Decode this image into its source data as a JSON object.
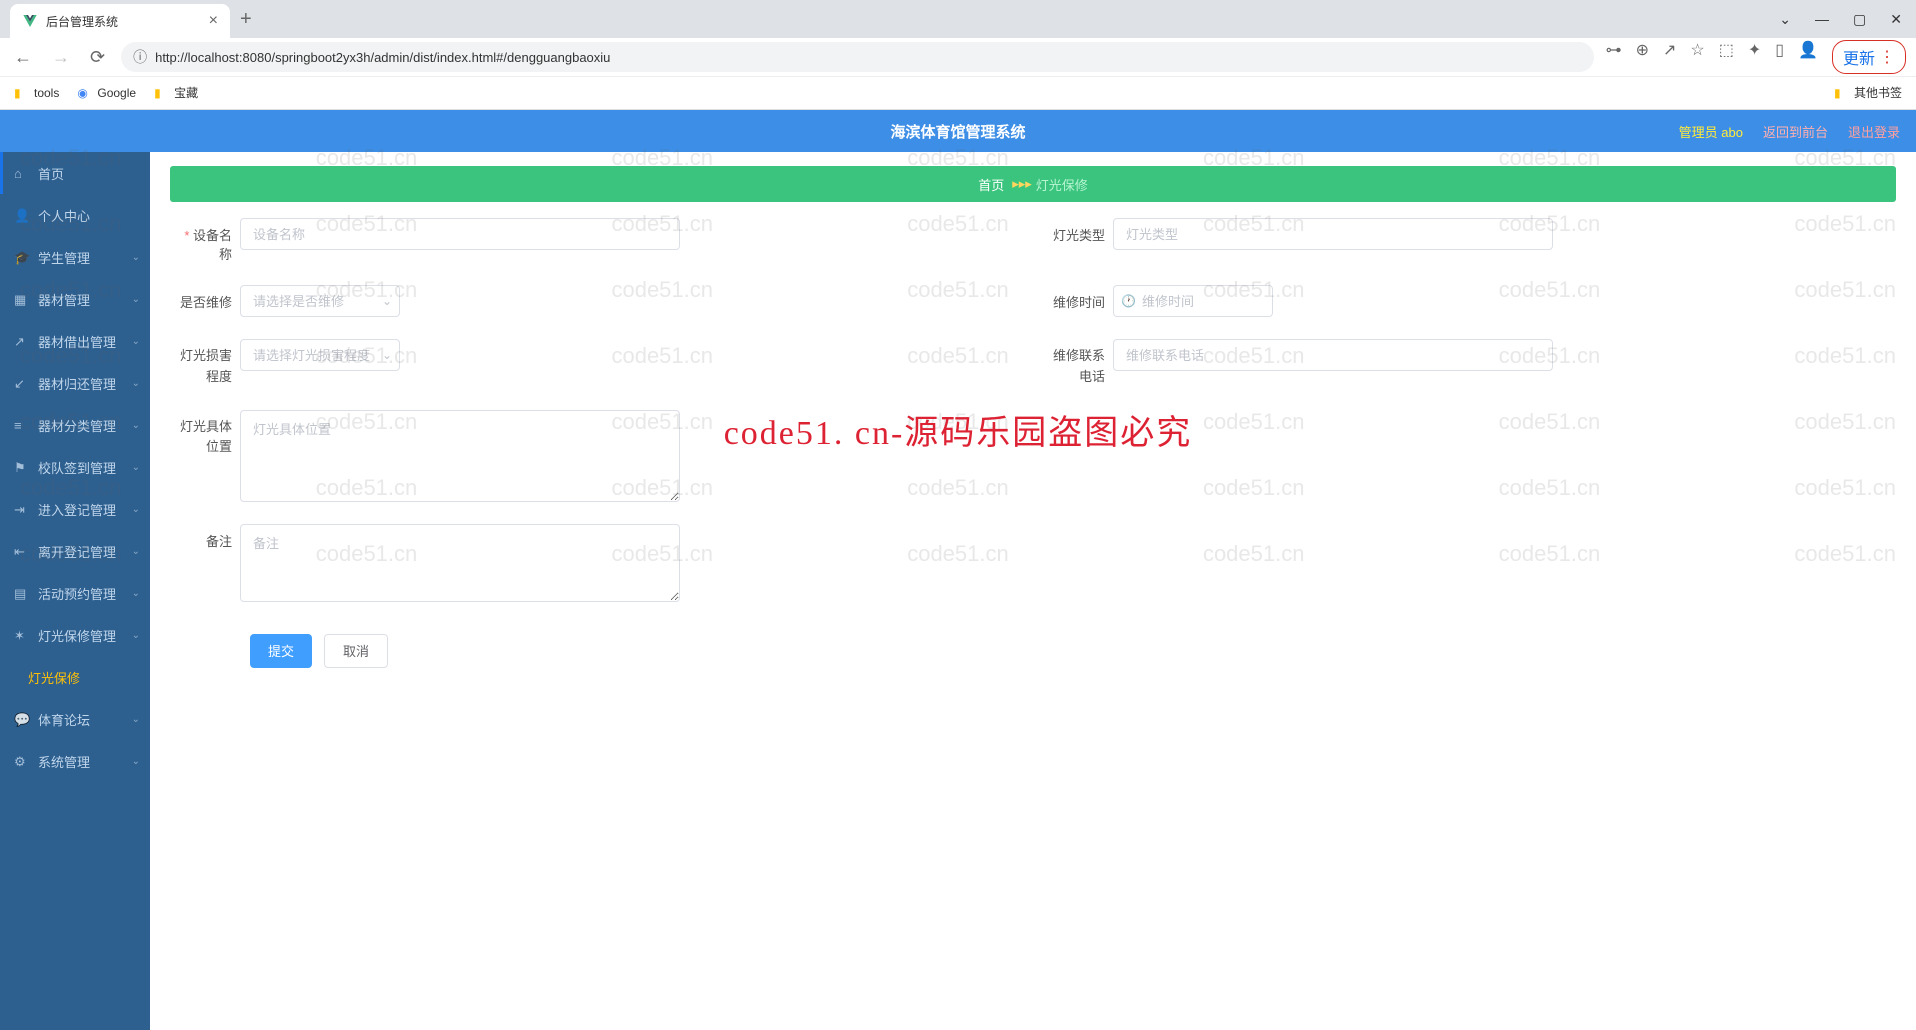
{
  "browser": {
    "tab_title": "后台管理系统",
    "url": "http://localhost:8080/springboot2yx3h/admin/dist/index.html#/dengguangbaoxiu",
    "bookmarks": [
      {
        "label": "tools",
        "type": "folder"
      },
      {
        "label": "Google",
        "type": "link"
      },
      {
        "label": "宝藏",
        "type": "folder"
      }
    ],
    "other_bookmarks": "其他书签",
    "update_label": "更新"
  },
  "header": {
    "title": "海滨体育馆管理系统",
    "admin": "管理员 abo",
    "return_link": "返回到前台",
    "logout_link": "退出登录"
  },
  "sidebar": {
    "items": [
      {
        "label": "首页",
        "has_children": false
      },
      {
        "label": "个人中心",
        "has_children": false
      },
      {
        "label": "学生管理",
        "has_children": true
      },
      {
        "label": "器材管理",
        "has_children": true
      },
      {
        "label": "器材借出管理",
        "has_children": true
      },
      {
        "label": "器材归还管理",
        "has_children": true
      },
      {
        "label": "器材分类管理",
        "has_children": true
      },
      {
        "label": "校队签到管理",
        "has_children": true
      },
      {
        "label": "进入登记管理",
        "has_children": true
      },
      {
        "label": "离开登记管理",
        "has_children": true
      },
      {
        "label": "活动预约管理",
        "has_children": true
      },
      {
        "label": "灯光保修管理",
        "has_children": true
      },
      {
        "label": "灯光保修",
        "has_children": false,
        "active": true,
        "sub": true
      },
      {
        "label": "体育论坛",
        "has_children": true
      },
      {
        "label": "系统管理",
        "has_children": true
      }
    ]
  },
  "breadcrumb": {
    "home": "首页",
    "current": "灯光保修"
  },
  "form": {
    "device_name": {
      "label": "设备名称",
      "placeholder": "设备名称"
    },
    "light_type": {
      "label": "灯光类型",
      "placeholder": "灯光类型"
    },
    "need_repair": {
      "label": "是否维修",
      "placeholder": "请选择是否维修"
    },
    "repair_time": {
      "label": "维修时间",
      "placeholder": "维修时间"
    },
    "damage_level": {
      "label": "灯光损害程度",
      "placeholder": "请选择灯光损害程度"
    },
    "contact_phone": {
      "label": "维修联系电话",
      "placeholder": "维修联系电话"
    },
    "position": {
      "label": "灯光具体位置",
      "placeholder": "灯光具体位置"
    },
    "remark": {
      "label": "备注",
      "placeholder": "备注"
    },
    "submit": "提交",
    "cancel": "取消"
  },
  "watermark": {
    "small": "code51.cn",
    "big": "code51. cn-源码乐园盗图必究"
  }
}
